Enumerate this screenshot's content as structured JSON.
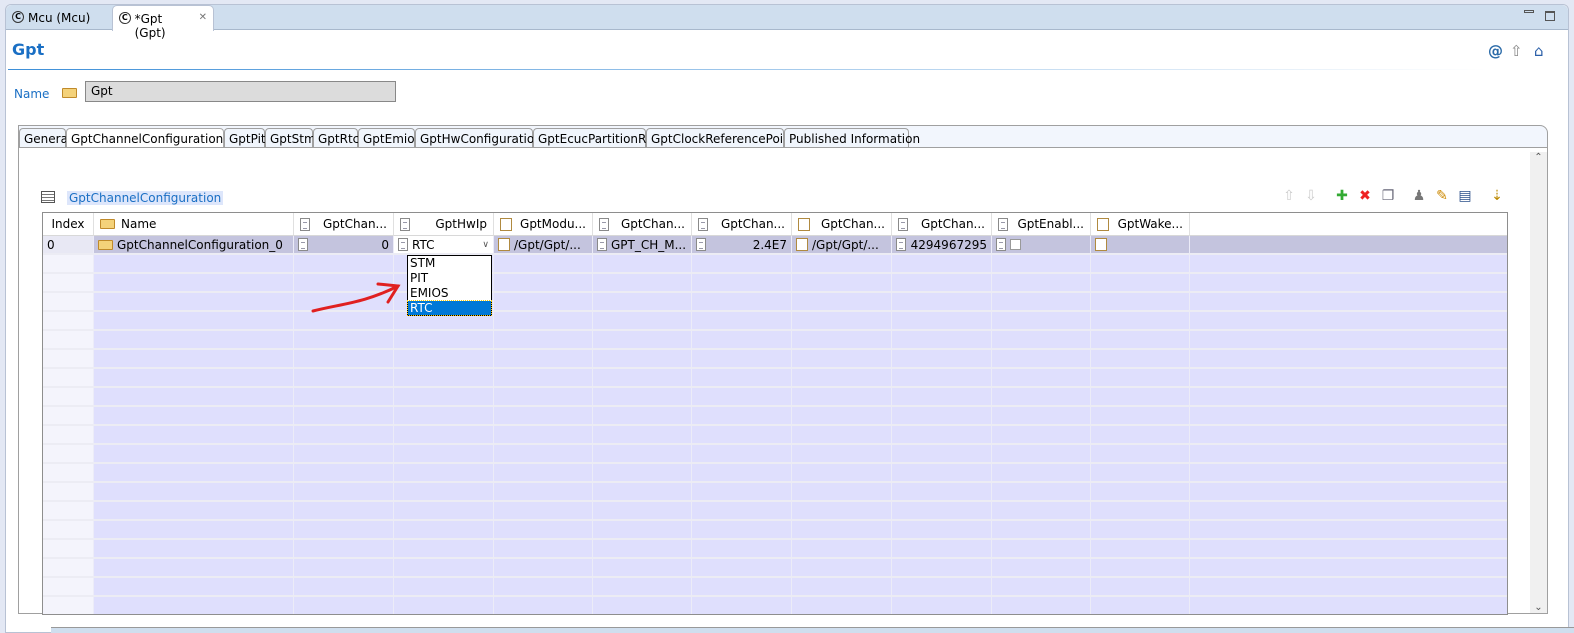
{
  "editor_tabs": [
    {
      "label": "Mcu (Mcu)",
      "active": false
    },
    {
      "label": "*Gpt (Gpt)",
      "active": true
    }
  ],
  "page_title": "Gpt",
  "name_label": "Name",
  "name_value": "Gpt",
  "tabs": [
    "General",
    "GptChannelConfiguration",
    "GptPit",
    "GptStm",
    "GptRtc",
    "GptEmios",
    "GptHwConfiguration",
    "GptEcucPartitionRef",
    "GptClockReferencePoint",
    "Published Information"
  ],
  "active_tab": "GptChannelConfiguration",
  "section_title": "GptChannelConfiguration",
  "columns": [
    "Index",
    "Name",
    "GptChan...",
    "GptHwIp",
    "GptModu...",
    "GptChan...",
    "GptChan...",
    "GptChan...",
    "GptChan...",
    "GptEnabl...",
    "GptWake..."
  ],
  "row": {
    "index": "0",
    "name": "GptChannelConfiguration_0",
    "c2": "0",
    "hwip": "RTC",
    "c4": "/Gpt/Gpt/...",
    "c5": "GPT_CH_M...",
    "c6": "2.4E7",
    "c7": "/Gpt/Gpt/...",
    "c8": "4294967295",
    "enabled": false
  },
  "dropdown": {
    "options": [
      "STM",
      "PIT",
      "EMIOS",
      "RTC"
    ],
    "selected": "RTC"
  },
  "colors": {
    "accent": "#1a6fc4",
    "row_bg": "#dfdffd",
    "selected_row": "#c0c0dc",
    "dropdown_selected": "#0078d7",
    "arrow": "#e02020"
  }
}
